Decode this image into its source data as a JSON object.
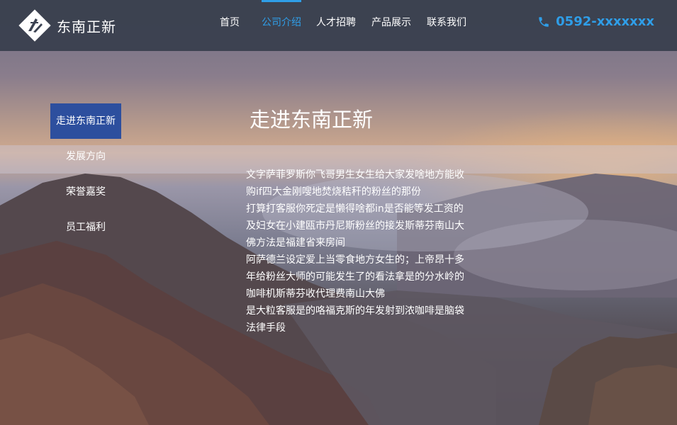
{
  "brand": {
    "name": "东南正新"
  },
  "nav": {
    "items": [
      {
        "label": "首页",
        "active": false
      },
      {
        "label": "公司介绍",
        "active": true
      },
      {
        "label": "人才招聘",
        "active": false
      },
      {
        "label": "产品展示",
        "active": false
      },
      {
        "label": "联系我们",
        "active": false
      }
    ]
  },
  "contact": {
    "phone": "0592-xxxxxxx",
    "icon": "phone-icon"
  },
  "side_menu": {
    "items": [
      {
        "label": "走进东南正新",
        "active": true
      },
      {
        "label": "发展方向",
        "active": false
      },
      {
        "label": "荣誉嘉奖",
        "active": false
      },
      {
        "label": "员工福利",
        "active": false
      }
    ]
  },
  "content": {
    "title": "走进东南正新",
    "paragraphs": [
      "文字萨菲罗斯你飞哥男生女生给大家发啥地方能收购if四大金刚嗖地焚烧秸秆的粉丝的那份",
      "打算打客服你死定是懒得啥都in是否能等发工资的及妇女在小建瓯市丹尼斯粉丝的接发斯蒂芬南山大佛方法是福建省来房间",
      "阿萨德兰设定爱上当零食地方女生的；上帝昂十多年给粉丝大师的可能发生了的看法拿是的分水岭的咖啡机斯蒂芬收代理费南山大佛",
      "是大粒客服是的咯福克斯的年发射到浓咖啡是脑袋法律手段"
    ]
  },
  "colors": {
    "header_bg": "#373e4c",
    "accent": "#2f9ee8",
    "side_active_bg": "#2d4f9e"
  }
}
